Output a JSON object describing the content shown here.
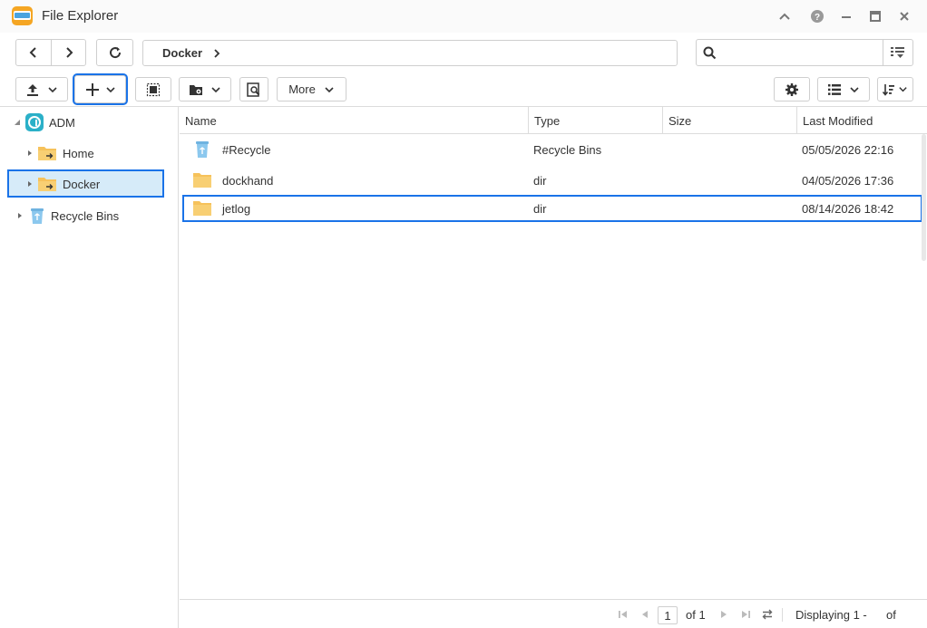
{
  "window": {
    "title": "File Explorer"
  },
  "nav": {
    "path": [
      "Docker"
    ],
    "search_placeholder": ""
  },
  "toolbar": {
    "more_label": "More"
  },
  "sidebar": {
    "root": "ADM",
    "items": [
      {
        "label": "Home"
      },
      {
        "label": "Docker",
        "selected": true
      }
    ],
    "recycle": "Recycle Bins"
  },
  "table": {
    "columns": [
      "Name",
      "Type",
      "Size",
      "Last Modified"
    ],
    "rows": [
      {
        "name": "#Recycle",
        "type": "Recycle Bins",
        "size": "",
        "modified": "05/05/2026 22:16",
        "icon": "recycle-bin-icon"
      },
      {
        "name": "dockhand",
        "type": "dir",
        "size": "",
        "modified": "04/05/2026 17:36",
        "icon": "folder-icon"
      },
      {
        "name": "jetlog",
        "type": "dir",
        "size": "",
        "modified": "08/14/2026 18:42",
        "icon": "folder-icon",
        "highlighted": true
      }
    ]
  },
  "footer": {
    "page": "1",
    "of_pages": "of 1",
    "displaying": "Displaying 1 -",
    "of": "of"
  },
  "colors": {
    "accent": "#1a73e8",
    "selection_bg": "#d6ebf9",
    "folder": "#f6c25b"
  }
}
